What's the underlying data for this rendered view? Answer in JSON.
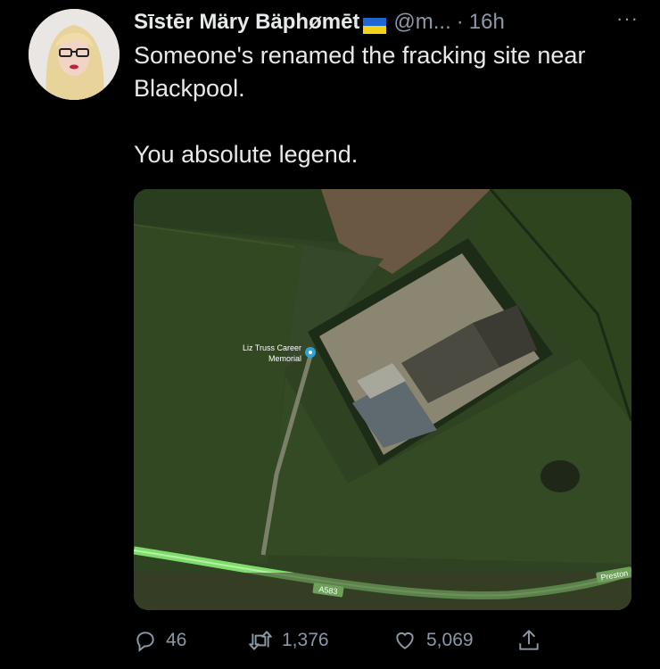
{
  "tweet": {
    "display_name": "Sīstēr Märy Bäphømēt",
    "handle": "@m...",
    "separator": "·",
    "time": "16h",
    "more": "···",
    "text_line1": "Someone's renamed the fracking site near Blackpool.",
    "text_line2": "You absolute legend."
  },
  "map": {
    "place_label_line1": "Liz Truss Career",
    "place_label_line2": "Memorial",
    "road_label": "A583",
    "road_label_2": "Preston"
  },
  "actions": {
    "replies": "46",
    "retweets": "1,376",
    "likes": "5,069"
  },
  "icons": [
    "flag-ukraine-icon",
    "reply-icon",
    "retweet-icon",
    "like-icon",
    "share-icon",
    "map-pin-icon"
  ],
  "colors": {
    "background": "#000000",
    "text": "#e7e9ea",
    "secondary": "#8b98a5",
    "road": "#7ddc6a"
  }
}
